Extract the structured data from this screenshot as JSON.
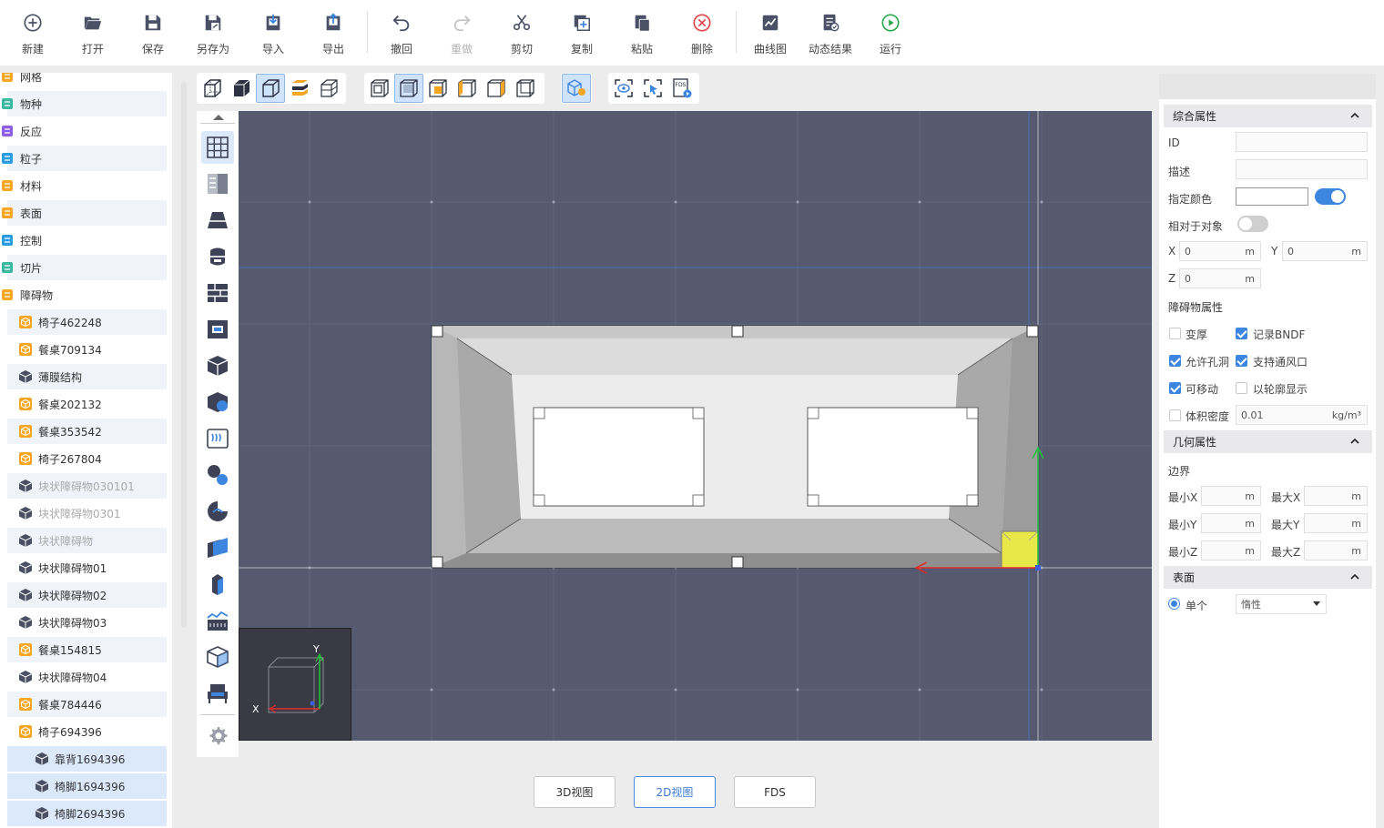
{
  "toolbar": {
    "items": [
      {
        "label": "新建",
        "icon": "plus-circle-icon"
      },
      {
        "label": "打开",
        "icon": "folder-open-icon"
      },
      {
        "label": "保存",
        "icon": "save-icon"
      },
      {
        "label": "另存为",
        "icon": "save-as-icon"
      },
      {
        "label": "导入",
        "icon": "import-icon"
      },
      {
        "label": "导出",
        "icon": "export-icon"
      },
      {
        "label": "撤回",
        "icon": "undo-icon"
      },
      {
        "label": "重做",
        "icon": "redo-icon",
        "disabled": true
      },
      {
        "label": "剪切",
        "icon": "scissors-icon"
      },
      {
        "label": "复制",
        "icon": "copy-icon"
      },
      {
        "label": "粘贴",
        "icon": "paste-icon"
      },
      {
        "label": "删除",
        "icon": "delete-circle-icon"
      },
      {
        "label": "曲线图",
        "icon": "line-chart-icon"
      },
      {
        "label": "动态结果",
        "icon": "dynamic-result-icon"
      },
      {
        "label": "运行",
        "icon": "run-play-icon"
      }
    ]
  },
  "tree": {
    "items": [
      {
        "label": "网格",
        "icon": "mesh-icon",
        "color": "#f5a623",
        "level": 0
      },
      {
        "label": "物种",
        "icon": "species-icon",
        "color": "#3bb8a0",
        "level": 0
      },
      {
        "label": "反应",
        "icon": "reaction-icon",
        "color": "#8e5ce6",
        "level": 0
      },
      {
        "label": "粒子",
        "icon": "particle-icon",
        "color": "#2a9de0",
        "level": 0
      },
      {
        "label": "材料",
        "icon": "material-icon",
        "color": "#f5a623",
        "level": 0
      },
      {
        "label": "表面",
        "icon": "surface-icon",
        "color": "#f5a623",
        "level": 0
      },
      {
        "label": "控制",
        "icon": "control-icon",
        "color": "#2a9de0",
        "level": 0
      },
      {
        "label": "切片",
        "icon": "slice-icon",
        "color": "#3bb8a0",
        "level": 0
      },
      {
        "label": "障碍物",
        "icon": "obstruction-icon",
        "color": "#f5a623",
        "level": 0
      },
      {
        "label": "椅子462248",
        "icon": "group-cube-icon",
        "color": "#f5a623",
        "level": 1
      },
      {
        "label": "餐桌709134",
        "icon": "group-cube-icon",
        "color": "#f5a623",
        "level": 1
      },
      {
        "label": "薄膜结构",
        "icon": "cube-icon",
        "color": "#4a4f63",
        "level": 1
      },
      {
        "label": "餐桌202132",
        "icon": "group-cube-icon",
        "color": "#f5a623",
        "level": 1
      },
      {
        "label": "餐桌353542",
        "icon": "group-cube-icon",
        "color": "#f5a623",
        "level": 1
      },
      {
        "label": "椅子267804",
        "icon": "group-cube-icon",
        "color": "#f5a623",
        "level": 1
      },
      {
        "label": "块状障碍物030101",
        "icon": "cube-icon",
        "color": "#4a4f63",
        "level": 1,
        "dim": true
      },
      {
        "label": "块状障碍物0301",
        "icon": "cube-icon",
        "color": "#4a4f63",
        "level": 1,
        "dim": true
      },
      {
        "label": "块状障碍物",
        "icon": "cube-icon",
        "color": "#4a4f63",
        "level": 1,
        "dim": true
      },
      {
        "label": "块状障碍物01",
        "icon": "cube-icon",
        "color": "#4a4f63",
        "level": 1
      },
      {
        "label": "块状障碍物02",
        "icon": "cube-icon",
        "color": "#4a4f63",
        "level": 1
      },
      {
        "label": "块状障碍物03",
        "icon": "cube-icon",
        "color": "#4a4f63",
        "level": 1
      },
      {
        "label": "餐桌154815",
        "icon": "group-cube-icon",
        "color": "#f5a623",
        "level": 1
      },
      {
        "label": "块状障碍物04",
        "icon": "cube-icon",
        "color": "#4a4f63",
        "level": 1
      },
      {
        "label": "餐桌784446",
        "icon": "group-cube-icon",
        "color": "#f5a623",
        "level": 1
      },
      {
        "label": "椅子694396",
        "icon": "group-cube-icon",
        "color": "#f5a623",
        "level": 1
      },
      {
        "label": "靠背1694396",
        "icon": "cube-icon",
        "color": "#4a4f63",
        "level": 2,
        "selected": true
      },
      {
        "label": "椅脚1694396",
        "icon": "cube-icon",
        "color": "#4a4f63",
        "level": 2,
        "selected": true
      },
      {
        "label": "椅脚2694396",
        "icon": "cube-icon",
        "color": "#4a4f63",
        "level": 2,
        "selected": true
      }
    ]
  },
  "viewport": {
    "axis_labels": {
      "x": "X",
      "y": "Y"
    }
  },
  "view_tabs": {
    "tab_3d": "3D视图",
    "tab_2d": "2D视图",
    "tab_fds": "FDS",
    "active": "2D视图"
  },
  "props": {
    "general": {
      "title": "综合属性",
      "id_label": "ID",
      "id_value": "",
      "desc_label": "描述",
      "desc_value": "",
      "color_label": "指定颜色",
      "color_toggle": true,
      "relative_label": "相对于对象",
      "relative_toggle": false,
      "x_label": "X",
      "x_value": "0",
      "y_label": "Y",
      "y_value": "0",
      "z_label": "Z",
      "z_value": "0",
      "unit_m": "m"
    },
    "obstruction": {
      "title": "障碍物属性",
      "thicken_label": "变厚",
      "thicken": false,
      "bndf_label": "记录BNDF",
      "bndf": true,
      "allow_hole_label": "允许孔洞",
      "allow_hole": true,
      "vent_label": "支持通风口",
      "vent": true,
      "movable_label": "可移动",
      "movable": true,
      "outline_label": "以轮廓显示",
      "outline": false,
      "bulk_density_label": "体积密度",
      "bulk_density": false,
      "bulk_density_value": "0.01",
      "bulk_density_unit": "kg/m³"
    },
    "geometry": {
      "title": "几何属性",
      "bounds_label": "边界",
      "min_x": "最小X",
      "max_x": "最大X",
      "min_y": "最小Y",
      "max_y": "最大Y",
      "min_z": "最小Z",
      "max_z": "最大Z",
      "unit": "m"
    },
    "surface": {
      "title": "表面",
      "single_label": "单个",
      "single_selected": true,
      "surface_value": "惰性"
    }
  },
  "colors": {
    "accent": "#3d86e0",
    "viewport_bg": "#555a70",
    "selection_yellow": "#e8e84a"
  }
}
